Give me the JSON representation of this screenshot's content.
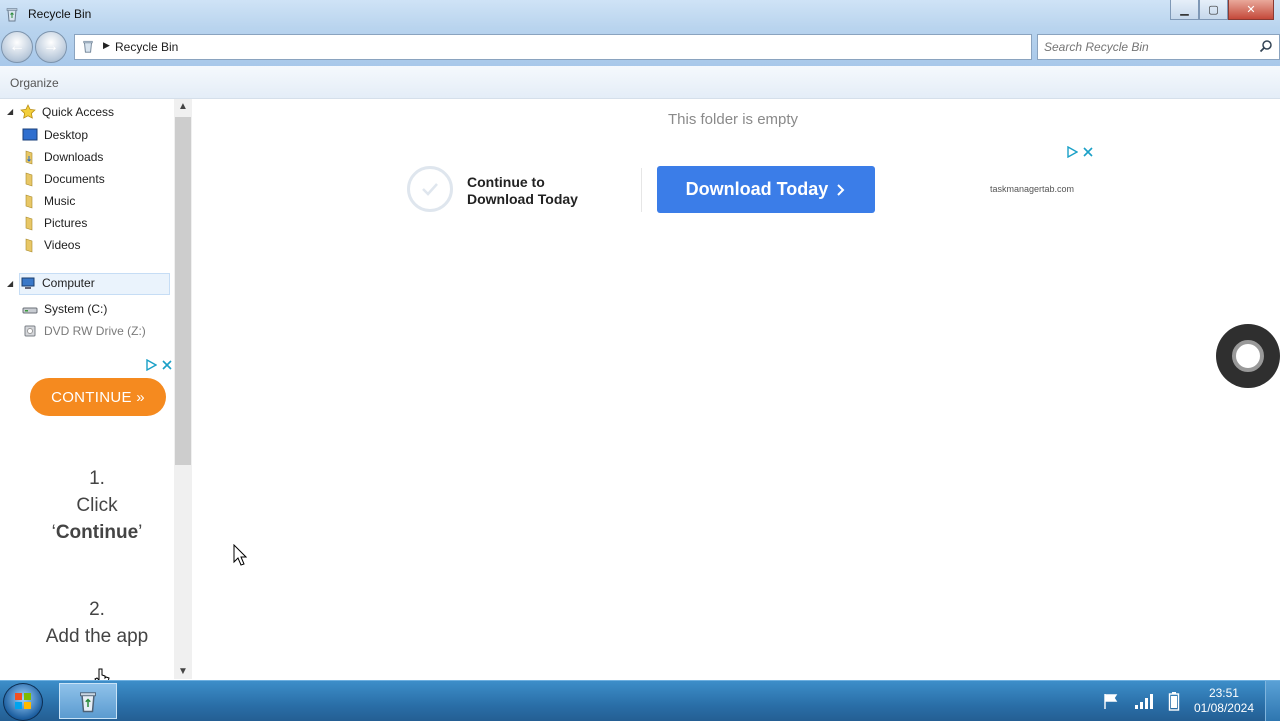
{
  "window": {
    "title": "Recycle Bin"
  },
  "address": {
    "path": "Recycle Bin"
  },
  "search": {
    "placeholder": "Search Recycle Bin"
  },
  "toolbar": {
    "organize_label": "Organize"
  },
  "sidebar": {
    "quick_access": "Quick Access",
    "items": [
      "Desktop",
      "Downloads",
      "Documents",
      "Music",
      "Pictures",
      "Videos"
    ],
    "computer": "Computer",
    "drives": [
      "System (C:)",
      "DVD RW Drive (Z:)"
    ]
  },
  "sidebar_ad": {
    "continue_label": "CONTINUE »",
    "step1_num": "1.",
    "step1_line1": "Click",
    "step1_quote_open": "‘",
    "step1_bold": "Continue",
    "step1_quote_close": "’",
    "step2_num": "2.",
    "step2_line1": "Add the app"
  },
  "main": {
    "empty_message": "This folder is empty",
    "ad": {
      "title_line1": "Continue to",
      "title_line2": "Download Today",
      "button_label": "Download Today",
      "domain": "taskmanagertab.com"
    }
  },
  "taskbar": {
    "time": "23:51",
    "date": "01/08/2024"
  },
  "colors": {
    "accent_blue": "#3b7de8",
    "continue_orange": "#f58a1f",
    "adchoices_cyan": "#1aa0c7"
  },
  "icons": [
    "recycle-bin-icon",
    "back-arrow-icon",
    "forward-arrow-icon",
    "search-icon",
    "star-icon",
    "desktop-icon",
    "folder-icon",
    "computer-icon",
    "drive-icon",
    "dvd-icon",
    "checkmark-icon",
    "adchoices-icon",
    "close-icon",
    "windows-logo-icon",
    "flag-icon",
    "network-icon",
    "battery-icon",
    "chevron-right-icon"
  ]
}
